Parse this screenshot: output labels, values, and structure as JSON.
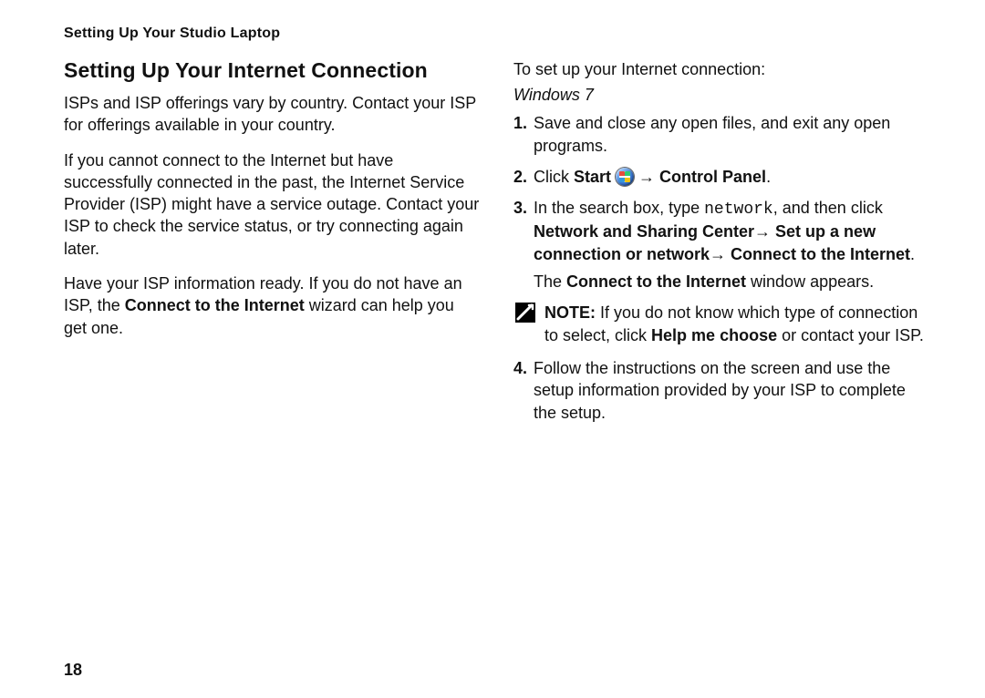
{
  "running_head": "Setting Up Your Studio Laptop",
  "section_title": "Setting Up Your Internet Connection",
  "left": {
    "p1": "ISPs and ISP offerings vary by country. Contact your ISP for offerings available in your country.",
    "p2": "If you cannot connect to the Internet but have successfully connected in the past, the Internet Service Provider (ISP) might have a service outage. Contact your ISP to check the service status, or try connecting again later.",
    "p3_pre": "Have your ISP information ready. If you do not have an ISP, the ",
    "p3_bold": "Connect to the Internet",
    "p3_post": " wizard can help you get one."
  },
  "right": {
    "lead": "To set up your Internet connection:",
    "os_label": "Windows 7",
    "step1": "Save and close any open files, and exit any open programs.",
    "step2_pre": "Click ",
    "step2_start": "Start",
    "step2_arrow": " → ",
    "step2_cp": "Control Panel",
    "step2_period": ".",
    "step3_pre": "In the search box, type ",
    "step3_code": "network",
    "step3_mid": ", and then click ",
    "step3_path": "Network and Sharing Center→ Set up a new connection or network→ Connect to the Internet",
    "step3_period": ".",
    "step3_result_pre": "The ",
    "step3_result_bold": "Connect to the Internet",
    "step3_result_post": " window appears.",
    "note_label": "NOTE:",
    "note_pre": " If you do not know which type of connection to select, click ",
    "note_bold": "Help me choose",
    "note_post": " or contact your ISP.",
    "step4": "Follow the instructions on the screen and use the setup information provided by your ISP to complete the setup."
  },
  "page_number": "18"
}
